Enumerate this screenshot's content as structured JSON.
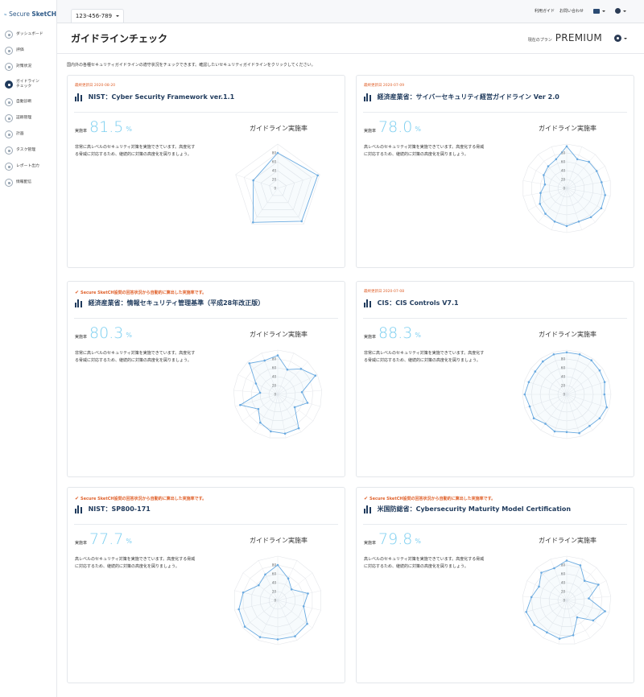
{
  "app": {
    "logo_text_a": "Secure ",
    "logo_text_b": "SketCH",
    "account": "123-456-789",
    "links": [
      "利用ガイド",
      "お問い合わせ"
    ],
    "colors": {
      "primary": "#1f3a5c",
      "accent": "#e0622c",
      "rate": "#7dcff0",
      "series": "#6aaae0"
    }
  },
  "sidebar": {
    "items": [
      {
        "label": "ダッシュボード",
        "icon": "dashboard-icon"
      },
      {
        "label": "評価",
        "icon": "evaluation-icon"
      },
      {
        "label": "対策状況",
        "icon": "check-icon"
      },
      {
        "label": "ガイドライン\nチェック",
        "icon": "guideline-icon",
        "active": true
      },
      {
        "label": "自動診断",
        "icon": "auto-diagnosis-icon"
      },
      {
        "label": "証跡管理",
        "icon": "evidence-icon"
      },
      {
        "label": "計画",
        "icon": "plan-icon"
      },
      {
        "label": "タスク管理",
        "icon": "task-icon"
      },
      {
        "label": "レポート出力",
        "icon": "report-icon"
      },
      {
        "label": "情報配信",
        "icon": "broadcast-icon"
      }
    ]
  },
  "page": {
    "title": "ガイドラインチェック",
    "plan_label": "現在のプラン",
    "plan_value": "PREMIUM",
    "intro": "国内外の各種セキュリティガイドラインの適守状況をチェックできます。確認したいセキュリティガイドラインをクリックしてください。"
  },
  "labels": {
    "rate_label": "実施率",
    "rate_unit": "%",
    "chart_title": "ガイドライン実施率",
    "auto_note": "Secure SketCH設問の回答状況から自動的に算出した実施率です。"
  },
  "cards": [
    {
      "meta": "最終更新日 2020-08-20",
      "title": "NIST：Cyber Security Framework ver.1.1",
      "rate": "81.5",
      "desc": "非常に高レベルのセキュリティ対策を実施できています。高度化する脅威に対応するため、継続的に対策の高度化を図りましょう。"
    },
    {
      "meta": "最終更新日 2020-07-09",
      "title": "経済産業省：サイバーセキュリティ経営ガイドライン Ver 2.0",
      "rate": "78.0",
      "desc": "高レベルのセキュリティ対策を実施できています。高度化する脅威に対応するため、継続的に対策の高度化を図りましょう。"
    },
    {
      "auto": true,
      "title": "経済産業省：情報セキュリティ管理基準（平成28年改正版）",
      "rate": "80.3",
      "desc": "非常に高レベルのセキュリティ対策を実施できています。高度化する脅威に対応するため、継続的に対策の高度化を図りましょう。"
    },
    {
      "meta": "最終更新日 2020-07-08",
      "title": "CIS：CIS Controls V7.1",
      "rate": "88.3",
      "desc": "非常に高レベルのセキュリティ対策を実施できています。高度化する脅威に対応するため、継続的に対策の高度化を図りましょう。"
    },
    {
      "auto": true,
      "title": "NIST：SP800-171",
      "rate": "77.7",
      "desc": "高レベルのセキュリティ対策を実施できています。高度化する脅威に対応するため、継続的に対策の高度化を図りましょう。"
    },
    {
      "auto": true,
      "title": "米国防総省：Cybersecurity Maturity Model Certification",
      "rate": "79.8",
      "desc": "高レベルのセキュリティ対策を実施できています。高度化する脅威に対応するため、継続的に対策の高度化を図りましょう。"
    }
  ],
  "chart_data": [
    {
      "type": "radar",
      "title": "ガイドライン実施率",
      "ticks": [
        "0",
        "20",
        "40",
        "60",
        "80"
      ],
      "rmax": 100,
      "values": [
        80,
        95,
        92,
        95,
        58
      ]
    },
    {
      "type": "radar",
      "title": "ガイドライン実施率",
      "ticks": [
        "0",
        "20",
        "40",
        "60",
        "80"
      ],
      "rmax": 100,
      "values": [
        95,
        70,
        78,
        78,
        80,
        88,
        90,
        85,
        80,
        85,
        80,
        75,
        70,
        60,
        50,
        60,
        65,
        70
      ]
    },
    {
      "type": "radar",
      "title": "ガイドライン実施率",
      "ticks": [
        "0",
        "20",
        "40",
        "60",
        "80"
      ],
      "rmax": 100,
      "values": [
        88,
        60,
        78,
        95,
        55,
        70,
        48,
        90,
        90,
        85,
        75,
        55,
        88,
        40,
        55,
        95,
        82
      ]
    },
    {
      "type": "radar",
      "title": "ガイドライン実施率",
      "ticks": [
        "0",
        "20",
        "40",
        "60",
        "80"
      ],
      "rmax": 100,
      "values": [
        95,
        95,
        95,
        92,
        90,
        85,
        95,
        92,
        88,
        92,
        85,
        88,
        82,
        92,
        88,
        95,
        90,
        88,
        92,
        95
      ]
    },
    {
      "type": "radar",
      "title": "ガイドライン実施率",
      "ticks": [
        "0",
        "20",
        "40",
        "60",
        "80"
      ],
      "rmax": 100,
      "values": [
        80,
        55,
        40,
        70,
        60,
        85,
        90,
        88,
        92,
        95,
        90,
        80,
        55,
        65
      ]
    },
    {
      "type": "radar",
      "title": "ガイドライン実施率",
      "ticks": [
        "0",
        "20",
        "40",
        "60",
        "80"
      ],
      "rmax": 100,
      "values": [
        90,
        85,
        60,
        80,
        50,
        90,
        75,
        45,
        80,
        88,
        85,
        92,
        95,
        80,
        70,
        85,
        78
      ]
    }
  ]
}
